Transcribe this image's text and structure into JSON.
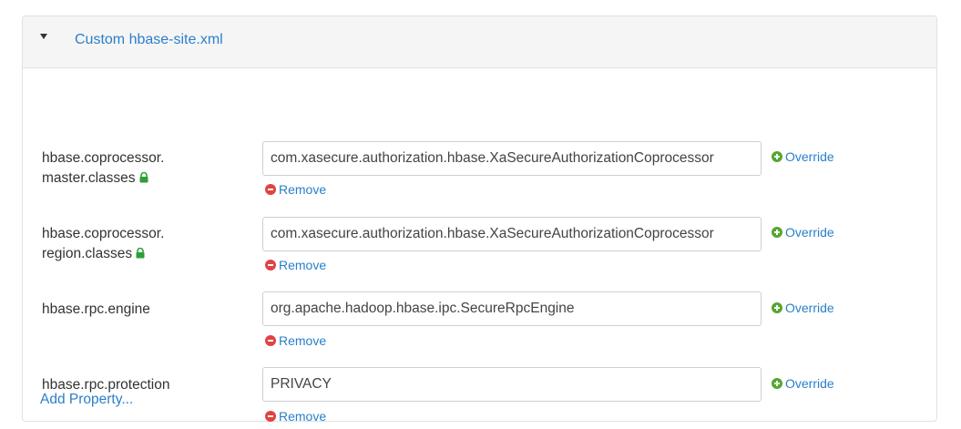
{
  "section": {
    "title": "Custom hbase-site.xml"
  },
  "properties": [
    {
      "label_line1": "hbase.coprocessor.",
      "label_line2": "master.classes",
      "locked": true,
      "value": "com.xasecure.authorization.hbase.XaSecureAuthorizationCoprocessor",
      "override_label": "Override",
      "remove_label": "Remove"
    },
    {
      "label_line1": "hbase.coprocessor.",
      "label_line2": "region.classes",
      "locked": true,
      "value": "com.xasecure.authorization.hbase.XaSecureAuthorizationCoprocessor",
      "override_label": "Override",
      "remove_label": "Remove"
    },
    {
      "label_line1": "hbase.rpc.engine",
      "value": "org.apache.hadoop.hbase.ipc.SecureRpcEngine",
      "override_label": "Override",
      "remove_label": "Remove"
    },
    {
      "label_line1": "hbase.rpc.protection",
      "value": "PRIVACY",
      "override_label": "Override",
      "remove_label": "Remove"
    }
  ],
  "add_property_label": "Add Property...",
  "colors": {
    "link": "#2a7fc9",
    "remove_icon": "#e04343",
    "override_icon": "#55a630",
    "lock_icon": "#2e9e3a"
  },
  "icons": [
    "caret-down-icon",
    "lock-icon",
    "remove-icon",
    "override-icon"
  ]
}
